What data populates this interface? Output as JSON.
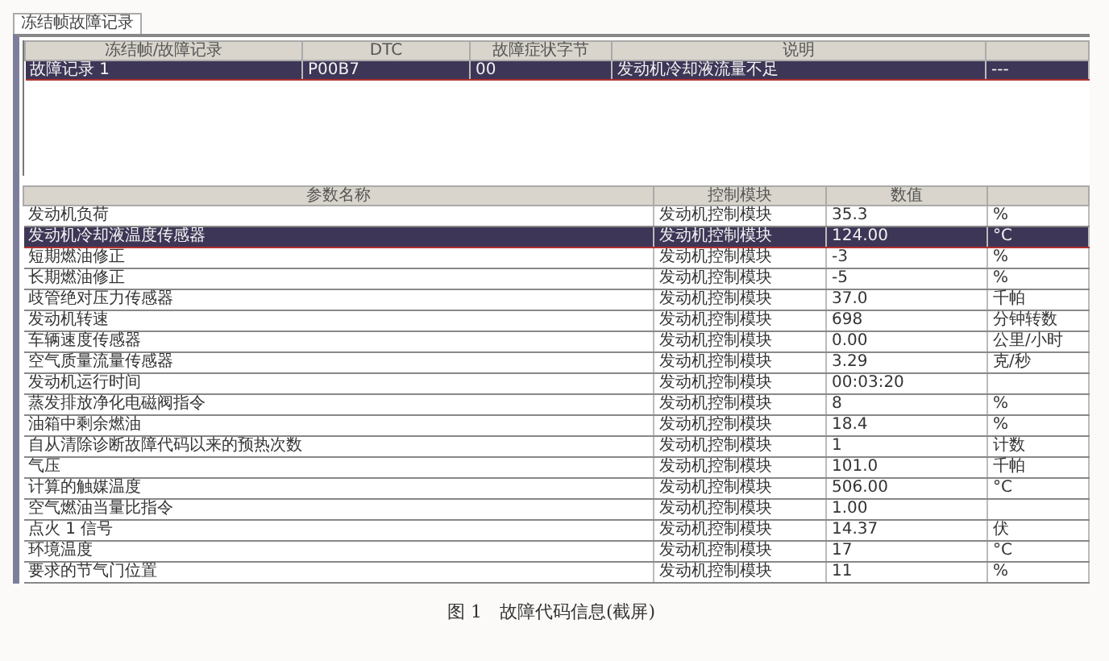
{
  "tabs": [
    {
      "label": "冻结帧故障记录",
      "selected": true
    }
  ],
  "fault_table": {
    "columns": [
      "冻结帧/故障记录",
      "DTC",
      "故障症状字节",
      "说明"
    ],
    "rows": [
      {
        "cells": [
          "故障记录 1",
          "P00B7",
          "00",
          "发动机冷却液流量不足",
          "---"
        ],
        "selected": true
      }
    ]
  },
  "param_table": {
    "columns": [
      "参数名称",
      "控制模块",
      "数值"
    ],
    "rows": [
      {
        "name": "发动机负荷",
        "module": "发动机控制模块",
        "value": "35.3",
        "unit": "%",
        "selected": false
      },
      {
        "name": "发动机冷却液温度传感器",
        "module": "发动机控制模块",
        "value": "124.00",
        "unit": "°C",
        "selected": true
      },
      {
        "name": "短期燃油修正",
        "module": "发动机控制模块",
        "value": "-3",
        "unit": "%",
        "selected": false
      },
      {
        "name": "长期燃油修正",
        "module": "发动机控制模块",
        "value": "-5",
        "unit": "%",
        "selected": false
      },
      {
        "name": "歧管绝对压力传感器",
        "module": "发动机控制模块",
        "value": "37.0",
        "unit": "千帕",
        "selected": false
      },
      {
        "name": "发动机转速",
        "module": "发动机控制模块",
        "value": "698",
        "unit": "分钟转数",
        "selected": false
      },
      {
        "name": "车辆速度传感器",
        "module": "发动机控制模块",
        "value": "0.00",
        "unit": "公里/小时",
        "selected": false
      },
      {
        "name": "空气质量流量传感器",
        "module": "发动机控制模块",
        "value": "3.29",
        "unit": "克/秒",
        "selected": false
      },
      {
        "name": "发动机运行时间",
        "module": "发动机控制模块",
        "value": "00:03:20",
        "selected": false
      },
      {
        "name": "蒸发排放净化电磁阀指令",
        "module": "发动机控制模块",
        "value": "8",
        "unit": "%",
        "selected": false
      },
      {
        "name": "油箱中剩余燃油",
        "module": "发动机控制模块",
        "value": "18.4",
        "unit": "%",
        "selected": false
      },
      {
        "name": "自从清除诊断故障代码以来的预热次数",
        "module": "发动机控制模块",
        "value": "1",
        "unit": "计数",
        "selected": false
      },
      {
        "name": "气压",
        "module": "发动机控制模块",
        "value": "101.0",
        "unit": "千帕",
        "selected": false
      },
      {
        "name": "计算的触媒温度",
        "module": "发动机控制模块",
        "value": "506.00",
        "unit": "°C",
        "selected": false
      },
      {
        "name": "空气燃油当量比指令",
        "module": "发动机控制模块",
        "value": "1.00",
        "selected": false
      },
      {
        "name": "点火 1 信号",
        "module": "发动机控制模块",
        "value": "14.37",
        "unit": "伏",
        "selected": false
      },
      {
        "name": "环境温度",
        "module": "发动机控制模块",
        "value": "17",
        "unit": "°C",
        "selected": false
      },
      {
        "name": "要求的节气门位置",
        "module": "发动机控制模块",
        "value": "11",
        "unit": "%",
        "selected": false
      }
    ]
  },
  "caption": "图 1　故障代码信息(截屏)"
}
